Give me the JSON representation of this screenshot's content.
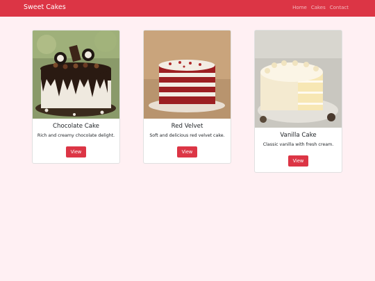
{
  "navbar": {
    "brand": "Sweet Cakes",
    "links": [
      "Home",
      "Cakes",
      "Contact"
    ]
  },
  "cards": [
    {
      "title": "Chocolate Cake",
      "text": "Rich and creamy chocolate delight.",
      "button": "View",
      "image": "chocolate-cake-photo"
    },
    {
      "title": "Red Velvet",
      "text": "Soft and delicious red velvet cake.",
      "button": "View",
      "image": "red-velvet-cake-photo"
    },
    {
      "title": "Vanilla Cake",
      "text": "Classic vanilla with fresh cream.",
      "button": "View",
      "image": "vanilla-cake-photo"
    }
  ],
  "colors": {
    "primary": "#dc3545",
    "page_background": "#fff0f3",
    "card_background": "#ffffff"
  }
}
